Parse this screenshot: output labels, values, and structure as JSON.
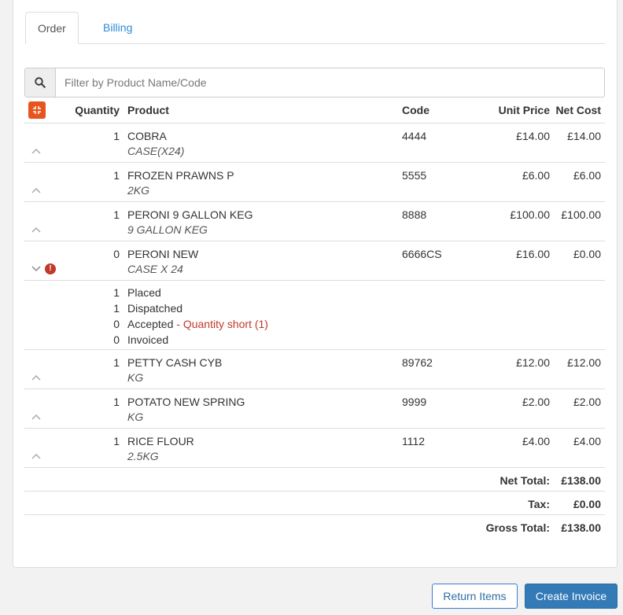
{
  "tabs": [
    {
      "label": "Order",
      "active": true
    },
    {
      "label": "Billing",
      "active": false
    }
  ],
  "search": {
    "placeholder": "Filter by Product Name/Code"
  },
  "columns": {
    "quantity": "Quantity",
    "product": "Product",
    "code": "Code",
    "unit_price": "Unit Price",
    "net_cost": "Net Cost"
  },
  "rows": [
    {
      "qty": "1",
      "product": "COBRA",
      "pack": "CASE(X24)",
      "code": "4444",
      "unit_price": "£14.00",
      "net_cost": "£14.00",
      "expanded": false
    },
    {
      "qty": "1",
      "product": "FROZEN PRAWNS P",
      "pack": "2KG",
      "code": "5555",
      "unit_price": "£6.00",
      "net_cost": "£6.00",
      "expanded": false
    },
    {
      "qty": "1",
      "product": "PERONI 9 GALLON KEG",
      "pack": "9 GALLON KEG",
      "code": "8888",
      "unit_price": "£100.00",
      "net_cost": "£100.00",
      "expanded": false
    },
    {
      "qty": "0",
      "product": "PERONI NEW",
      "pack": "CASE X 24",
      "code": "6666CS",
      "unit_price": "£16.00",
      "net_cost": "£0.00",
      "expanded": true,
      "warning": true
    },
    {
      "qty": "1",
      "product": "PETTY CASH CYB",
      "pack": "KG",
      "code": "89762",
      "unit_price": "£12.00",
      "net_cost": "£12.00",
      "expanded": false
    },
    {
      "qty": "1",
      "product": "POTATO NEW SPRING",
      "pack": "KG",
      "code": "9999",
      "unit_price": "£2.00",
      "net_cost": "£2.00",
      "expanded": false
    },
    {
      "qty": "1",
      "product": "RICE FLOUR",
      "pack": "2.5KG",
      "code": "1112",
      "unit_price": "£4.00",
      "net_cost": "£4.00",
      "expanded": false
    }
  ],
  "detail": {
    "lines": [
      {
        "qty": "1",
        "label": "Placed"
      },
      {
        "qty": "1",
        "label": "Dispatched"
      },
      {
        "qty": "0",
        "label": "Accepted",
        "note": " - Quantity short (1)"
      },
      {
        "qty": "0",
        "label": "Invoiced"
      }
    ]
  },
  "totals": {
    "net_label": "Net Total:",
    "net_value": "£138.00",
    "tax_label": "Tax:",
    "tax_value": "£0.00",
    "gross_label": "Gross Total:",
    "gross_value": "£138.00"
  },
  "buttons": {
    "return_items": "Return Items",
    "create_invoice": "Create Invoice"
  },
  "colors": {
    "accent": "#337ab7",
    "collapse_button": "#e8541e",
    "warning": "#c0392b",
    "link": "#2e8bd6"
  }
}
